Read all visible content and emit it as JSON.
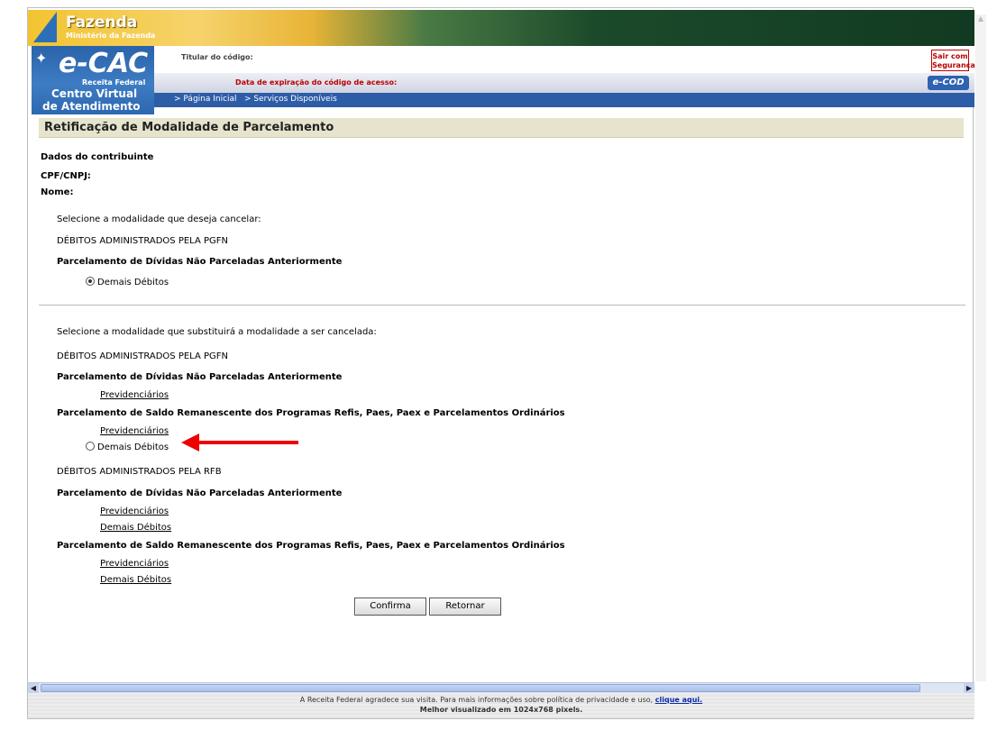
{
  "header": {
    "fazenda_title": "Fazenda",
    "fazenda_subtitle": "Ministério da Fazenda",
    "logo_main": "e-CAC",
    "logo_receita": "Receita Federal",
    "logo_centro": "Centro Virtual",
    "logo_atendimento": "de Atendimento",
    "titular_label": "Titular do código:",
    "expiracao_label": "Data de expiração do código de acesso:",
    "sair_line1": "Sair com",
    "sair_line2": "Segurança",
    "ecod_label": "e-COD",
    "nav": [
      "> Página Inicial",
      "> Serviços Disponíveis"
    ]
  },
  "page_title": "Retificação de Modalidade de Parcelamento",
  "contribuinte": {
    "heading": "Dados do contribuinte",
    "cpf_label": "CPF/CNPJ:",
    "nome_label": "Nome:"
  },
  "cancel_section": {
    "prompt": "Selecione a modalidade que deseja cancelar:",
    "group": "DÉBITOS ADMINISTRADOS PELA PGFN",
    "subgroup": "Parcelamento de Dívidas Não Parceladas Anteriormente",
    "option_selected": "Demais Débitos"
  },
  "replace_section": {
    "prompt": "Selecione a modalidade que substituirá a modalidade a ser cancelada:",
    "pgfn_group": "DÉBITOS ADMINISTRADOS PELA PGFN",
    "pgfn_sub1": "Parcelamento de Dívidas Não Parceladas Anteriormente",
    "pgfn_sub1_item1": "Previdenciários",
    "pgfn_sub2": "Parcelamento de Saldo Remanescente dos Programas Refis, Paes, Paex e Parcelamentos Ordinários",
    "pgfn_sub2_item1": "Previdenciários",
    "pgfn_sub2_radio": "Demais Débitos",
    "rfb_group": "DÉBITOS ADMINISTRADOS PELA RFB",
    "rfb_sub1": "Parcelamento de Dívidas Não Parceladas Anteriormente",
    "rfb_sub1_item1": "Previdenciários",
    "rfb_sub1_item2": "Demais Débitos",
    "rfb_sub2": "Parcelamento de Saldo Remanescente dos Programas Refis, Paes, Paex e Parcelamentos Ordinários",
    "rfb_sub2_item1": "Previdenciários",
    "rfb_sub2_item2": "Demais Débitos"
  },
  "buttons": {
    "confirma": "Confirma",
    "retornar": "Retornar"
  },
  "footer": {
    "line1": "A Receita Federal agradece sua visita. Para mais informações sobre política de privacidade e uso, ",
    "link": "clique aqui.",
    "line2": "Melhor visualizado em 1024x768 pixels."
  },
  "colors": {
    "nav_blue": "#2e5da8",
    "title_bar": "#e6e4cc",
    "annotation_arrow": "#ee0000"
  }
}
